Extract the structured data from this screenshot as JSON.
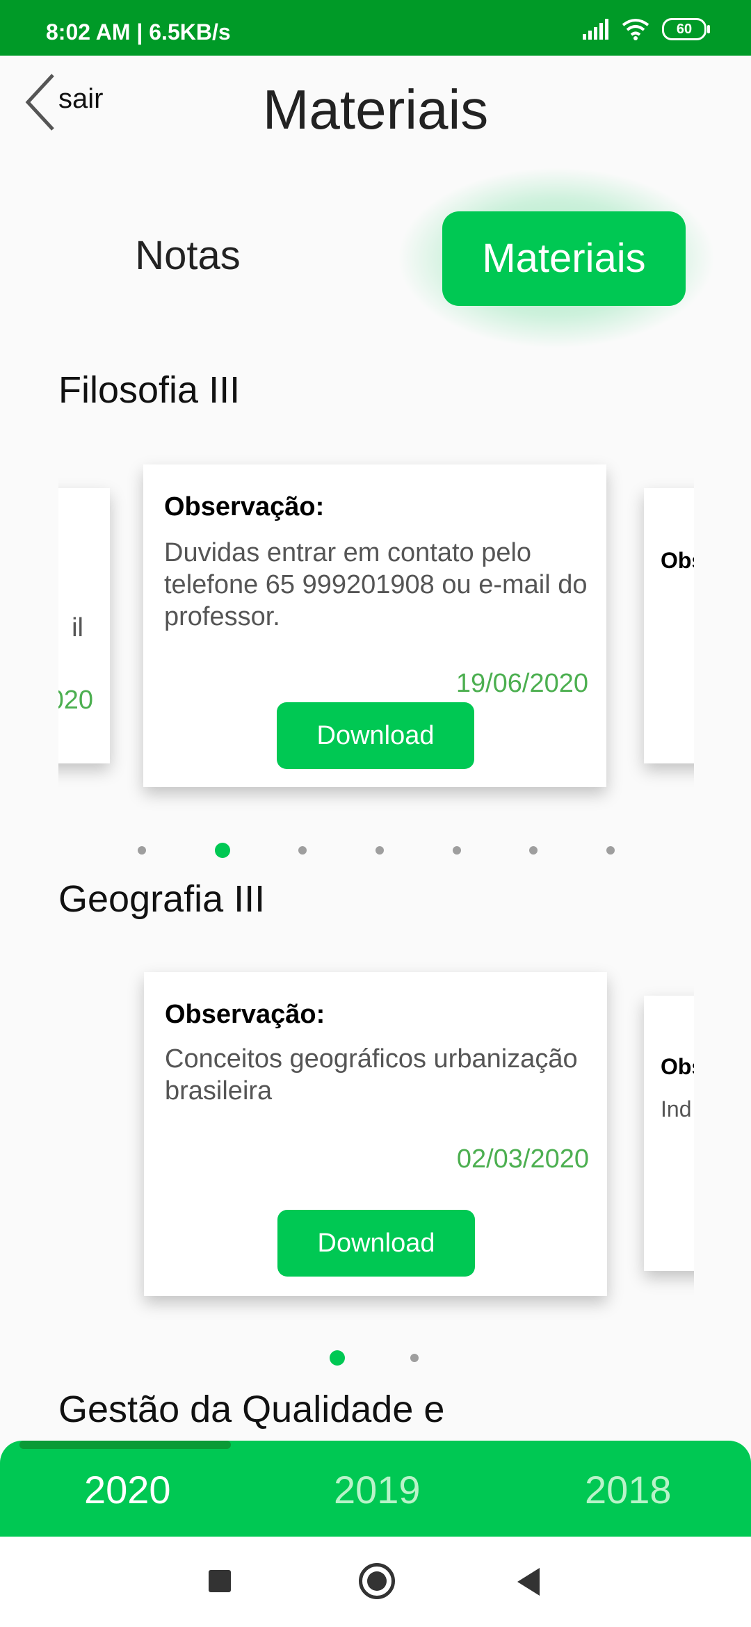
{
  "status_bar": {
    "time": "8:02 AM | 6.5KB/s",
    "battery": "60"
  },
  "header": {
    "back_label": "sair",
    "title": "Materiais"
  },
  "tabs": {
    "notas": "Notas",
    "materiais": "Materiais",
    "active": "Materiais"
  },
  "sections": [
    {
      "title": "Filosofia III",
      "left_card": {
        "partial_text": "il",
        "partial_date": "020"
      },
      "card": {
        "obs_label": "Observação:",
        "text": "Duvidas entrar em contato pelo telefone 65 999201908 ou e-mail do professor.",
        "date": "19/06/2020",
        "button": "Download"
      },
      "right_card": {
        "partial_label": "Obs",
        "partial_text": ""
      },
      "dots": {
        "count": 7,
        "active_index": 1
      }
    },
    {
      "title": "Geografia III",
      "card": {
        "obs_label": "Observação:",
        "text": "Conceitos geográficos urbanização brasileira",
        "date": "02/03/2020",
        "button": "Download"
      },
      "right_card": {
        "partial_label": "Obs",
        "partial_text": "Ind"
      },
      "dots": {
        "count": 2,
        "active_index": 0
      }
    },
    {
      "title": "Gestão da Qualidade e"
    }
  ],
  "years": {
    "items": [
      "2020",
      "2019",
      "2018"
    ],
    "active": "2020"
  }
}
